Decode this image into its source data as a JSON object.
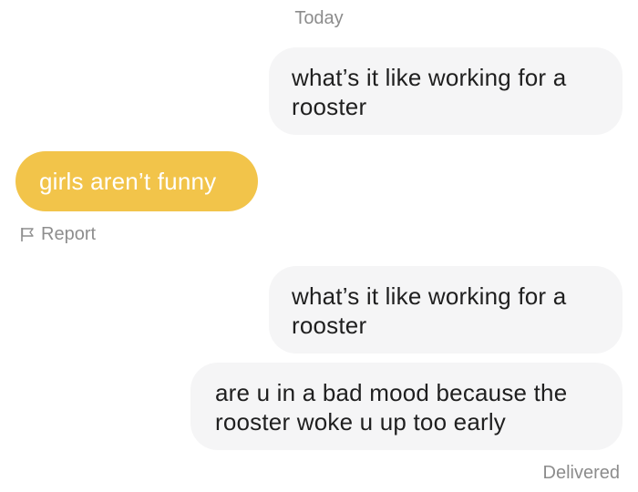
{
  "conversation": {
    "date_label": "Today",
    "messages": [
      {
        "direction": "outgoing",
        "text": "what’s it like working for a rooster"
      },
      {
        "direction": "incoming",
        "text": "girls aren’t funny"
      },
      {
        "direction": "outgoing",
        "text": "what’s it like working for a rooster"
      },
      {
        "direction": "outgoing",
        "text": "are u in a bad mood because the rooster woke u up too early"
      }
    ],
    "report_label": "Report",
    "report_icon": "flag-icon",
    "status": "Delivered"
  },
  "colors": {
    "incoming_bubble": "#f2c44a",
    "outgoing_bubble": "#f5f5f6",
    "meta_text": "#8c8c8c"
  }
}
